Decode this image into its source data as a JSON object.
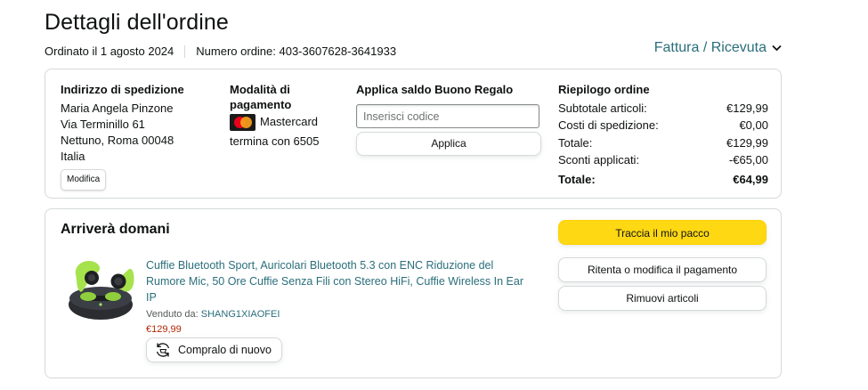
{
  "page": {
    "title": "Dettagli dell'ordine",
    "ordered_on": "Ordinato il 1 agosto 2024",
    "order_number": "Numero ordine: 403-3607628-3641933",
    "invoice_label": "Fattura / Ricevuta"
  },
  "shipping": {
    "heading": "Indirizzo di spedizione",
    "lines": [
      "Maria Angela Pinzone",
      "Via Terminillo 61",
      "Nettuno, Roma 00048",
      "Italia"
    ],
    "edit_label": "Modifica"
  },
  "payment": {
    "heading": "Modalità di pagamento",
    "card_name": "Mastercard",
    "card_ending": "termina con 6505",
    "card_logo_text": "MasterCard"
  },
  "gift": {
    "heading": "Applica saldo Buono Regalo",
    "placeholder": "Inserisci codice",
    "apply_label": "Applica"
  },
  "summary": {
    "heading": "Riepilogo ordine",
    "rows": [
      {
        "label": "Subtotale articoli:",
        "value": "€129,99"
      },
      {
        "label": "Costi di spedizione:",
        "value": "€0,00"
      },
      {
        "label": "Totale:",
        "value": "€129,99"
      },
      {
        "label": "Sconti applicati:",
        "value": "-€65,00"
      },
      {
        "label": "Totale:",
        "value": "€64,99"
      }
    ]
  },
  "delivery": {
    "title": "Arriverà domani",
    "product_title": "Cuffie Bluetooth Sport, Auricolari Bluetooth 5.3 con ENC Riduzione del Rumore Mic, 50 Ore Cuffie Senza Fili con Stereo HiFi, Cuffie Wireless In Ear IP",
    "seller_prefix": "Venduto da: ",
    "seller_name": "SHANG1XIAOFEI",
    "price": "€129,99",
    "buy_again_label": "Compralo di nuovo",
    "track_label": "Traccia il mio pacco",
    "retry_payment_label": "Ritenta o modifica il pagamento",
    "remove_label": "Rimuovi articoli"
  },
  "colors": {
    "link": "#2a6e7b",
    "primary_button": "#ffd814",
    "price": "#b12704",
    "border": "#d5d9d9"
  },
  "icons": [
    "chevron-down-icon",
    "mastercard-icon",
    "buy-again-icon",
    "product-image"
  ]
}
